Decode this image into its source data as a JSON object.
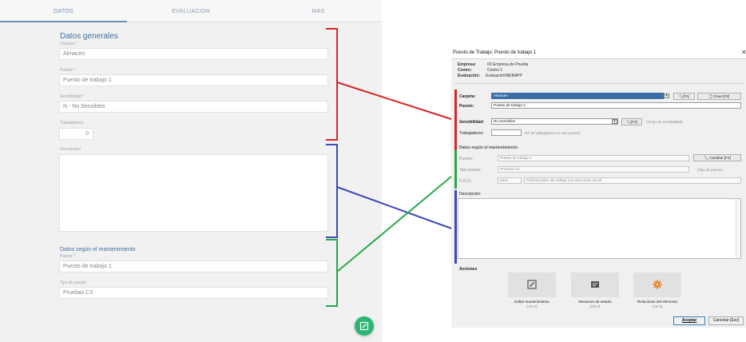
{
  "mobile": {
    "tabs": [
      {
        "label": "DATOS"
      },
      {
        "label": "EVALUACIÓN"
      },
      {
        "label": "MÁS"
      }
    ],
    "general": {
      "title": "Datos generales",
      "carpeta_label": "Carpeta *",
      "carpeta_value": "Almacen",
      "puesto_label": "Puesto *",
      "puesto_value": "Puesto de trabajo 1",
      "sensibilidad_label": "Sensibilidad *",
      "sensibilidad_value": "N - No Sensibles",
      "trabajadores_label": "Trabajadores",
      "trabajadores_value": "0",
      "descripcion_label": "Descripción"
    },
    "mantenimiento": {
      "title": "Datos según el mantenimiento",
      "puesto_label": "Puesto *",
      "puesto_value": "Puesto de trabajo 1",
      "tipo_label": "Tipo de puesto",
      "tipo_value": "Pruebas C3"
    },
    "fab_icon": "edit-icon",
    "accent_color": "#2bb673"
  },
  "connectors": {
    "red": "#d9262c",
    "blue": "#3f48b5",
    "green": "#2aa84a"
  },
  "dialog": {
    "title": "Puesto de Trabajo: Puesto de trabajo 1",
    "close_icon": "close-icon",
    "empresa_label": "Empresa:",
    "empresa_value": "00 Empresa de Prueba",
    "centro_label": "Centro:",
    "centro_value": "Centro 1",
    "evaluacion_label": "Evaluación:",
    "evaluacion_value": "EvaluaciónWEBAPP",
    "carpeta_label": "Carpeta:",
    "carpeta_value": "Almacen",
    "f1_button": "[F1]",
    "crear_button": "Crear [F2]",
    "puesto_label": "Puesto:",
    "puesto_value": "Puesto de trabajo 1",
    "sensibilidad_label": "Sensibilidad:",
    "sensibilidad_value": "No Sensibles",
    "f3_button": "[F3]",
    "sensibilidad_hint": "(Grupo de sensibilidad)",
    "trabajadores_label": "Trabajadores:",
    "trabajadores_hint": "(Nº de trabajadores en este puesto)",
    "mant_title": "Datos según el mantenimiento:",
    "mant_puesto_label": "Puesto:",
    "mant_puesto_value": "Puesto de trabajo 1",
    "cambiar_button": "Cambiar [F4]",
    "tipo_label": "Tipo puesto:",
    "tipo_value": "Pruebas C3",
    "tipo_hint": "(Tipo de puesto)",
    "cno_label": "C.N.O.:",
    "cno_code": "2824",
    "cno_desc": "Profesionales del trabajo y la educación social",
    "descripcion_label": "Descripción:",
    "acciones_title": "Acciones",
    "actions": [
      {
        "label": "Editar mantenimiento",
        "shortcut": "(Alt+1)",
        "icon": "edit-icon"
      },
      {
        "label": "Resumen de estado",
        "shortcut": "(Alt+4)",
        "icon": "summary-icon"
      },
      {
        "label": "Relaciones del elemento",
        "shortcut": "(Alt+5)",
        "icon": "gear-icon"
      }
    ],
    "aceptar_button": "Aceptar",
    "cancelar_button": "Cancelar [Esc]"
  }
}
